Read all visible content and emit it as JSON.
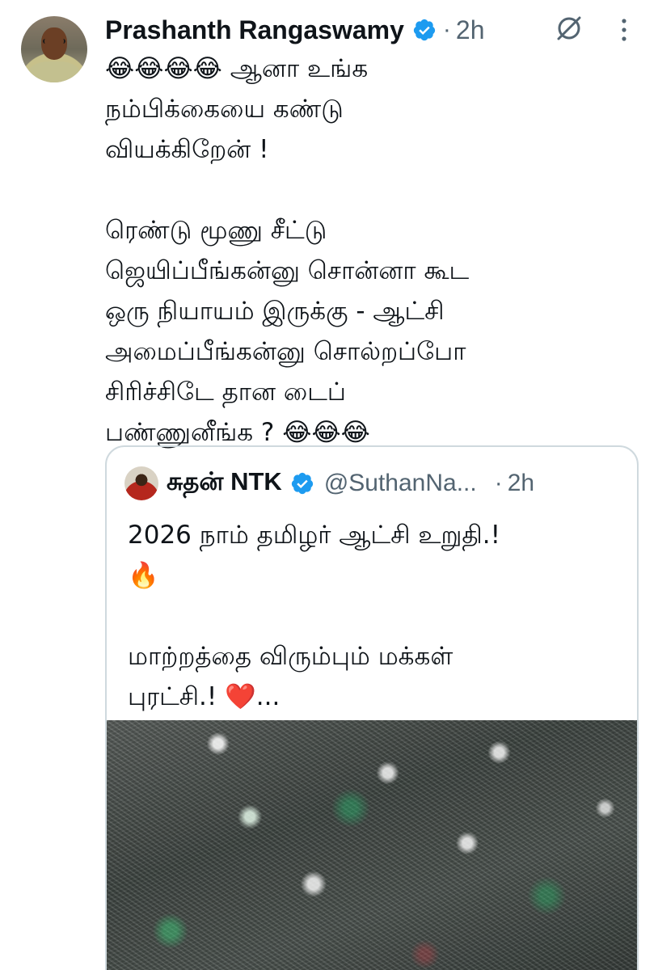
{
  "tweet": {
    "author_name": "Prashanth Rangaswamy",
    "dot": "·",
    "time": "2h",
    "text_lines": [
      "😂😂😂😂 ஆனா உங்க",
      "நம்பிக்கையை கண்டு",
      "வியக்கிறேன் !",
      "",
      "ரெண்டு மூணு சீட்டு",
      "ஜெயிப்பீங்கன்னு சொன்னா கூட",
      "ஒரு நியாயம் இருக்கு - ஆட்சி",
      "அமைப்பீங்கன்னு சொல்றப்போ",
      "சிரிச்சிடே தான டைப்",
      "பண்ணுனீங்க ? 😂😂😂"
    ],
    "icons": {
      "verified": "verified-badge-icon",
      "grok": "grok-icon",
      "more": "more-vertical-icon"
    }
  },
  "quoted_tweet": {
    "author_name": "சுதன் NTK",
    "handle": "@SuthanNa...",
    "dot": "·",
    "time": "2h",
    "text_lines": [
      "2026 நாம் தமிழர் ஆட்சி உறுதி.!",
      "🔥",
      "",
      "மாற்றத்தை விரும்பும் மக்கள்",
      "புரட்சி.! ❤️..."
    ],
    "media": "crowd-photo"
  },
  "colors": {
    "verified_blue": "#1d9bf0",
    "secondary_text": "#536471",
    "border": "#cfd9de"
  }
}
